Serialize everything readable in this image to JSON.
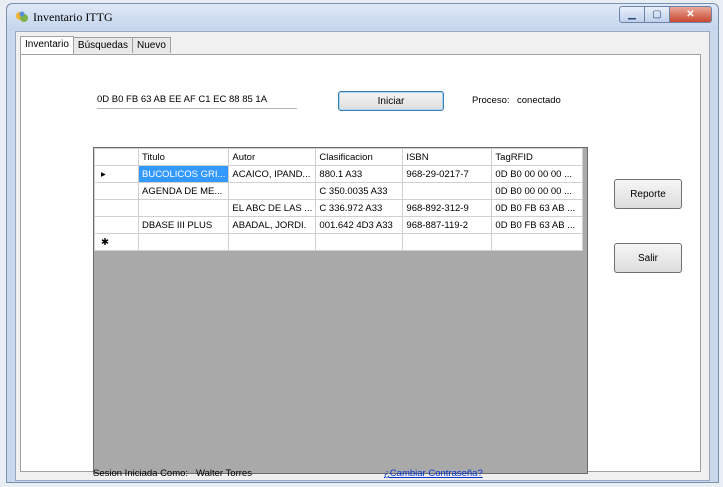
{
  "window": {
    "title": "Inventario ITTG"
  },
  "tabs": [
    {
      "label": "Inventario"
    },
    {
      "label": "Búsquedas"
    },
    {
      "label": "Nuevo"
    }
  ],
  "rfid_tag": "0D B0 FB 63 AB EE AF C1 EC 88 85 1A",
  "iniciar_label": "Iniciar",
  "proceso": {
    "label": "Proceso:",
    "value": "conectado"
  },
  "grid": {
    "columns": [
      "Titulo",
      "Autor",
      "Clasificacion",
      "ISBN",
      "TagRFID"
    ],
    "rows": [
      {
        "marker": "▸",
        "cells": [
          "BUCOLICOS GRI...",
          "ACAICO, IPAND...",
          "880.1 A33",
          "968-29-0217-7",
          "0D B0 00 00 00 ..."
        ]
      },
      {
        "marker": "",
        "cells": [
          "AGENDA DE ME...",
          "",
          "C 350.0035 A33",
          "",
          "0D B0 00 00 00 ..."
        ]
      },
      {
        "marker": "",
        "cells": [
          "",
          "EL ABC DE LAS ...",
          "C 336.972 A33",
          "968-892-312-9",
          "0D B0 FB 63 AB ..."
        ]
      },
      {
        "marker": "",
        "cells": [
          "DBASE III PLUS",
          "ABADAL, JORDI.",
          "001.642 4D3 A33",
          "968-887-119-2",
          "0D B0 FB 63 AB ..."
        ]
      },
      {
        "marker": "✱",
        "cells": [
          "",
          "",
          "",
          "",
          ""
        ]
      }
    ]
  },
  "buttons": {
    "reporte": "Reporte",
    "salir": "Salir"
  },
  "session": {
    "label": "Sesion Iniciada Como:",
    "user": "Walter Torres"
  },
  "change_password": "¿Cambiar Contraseña?"
}
